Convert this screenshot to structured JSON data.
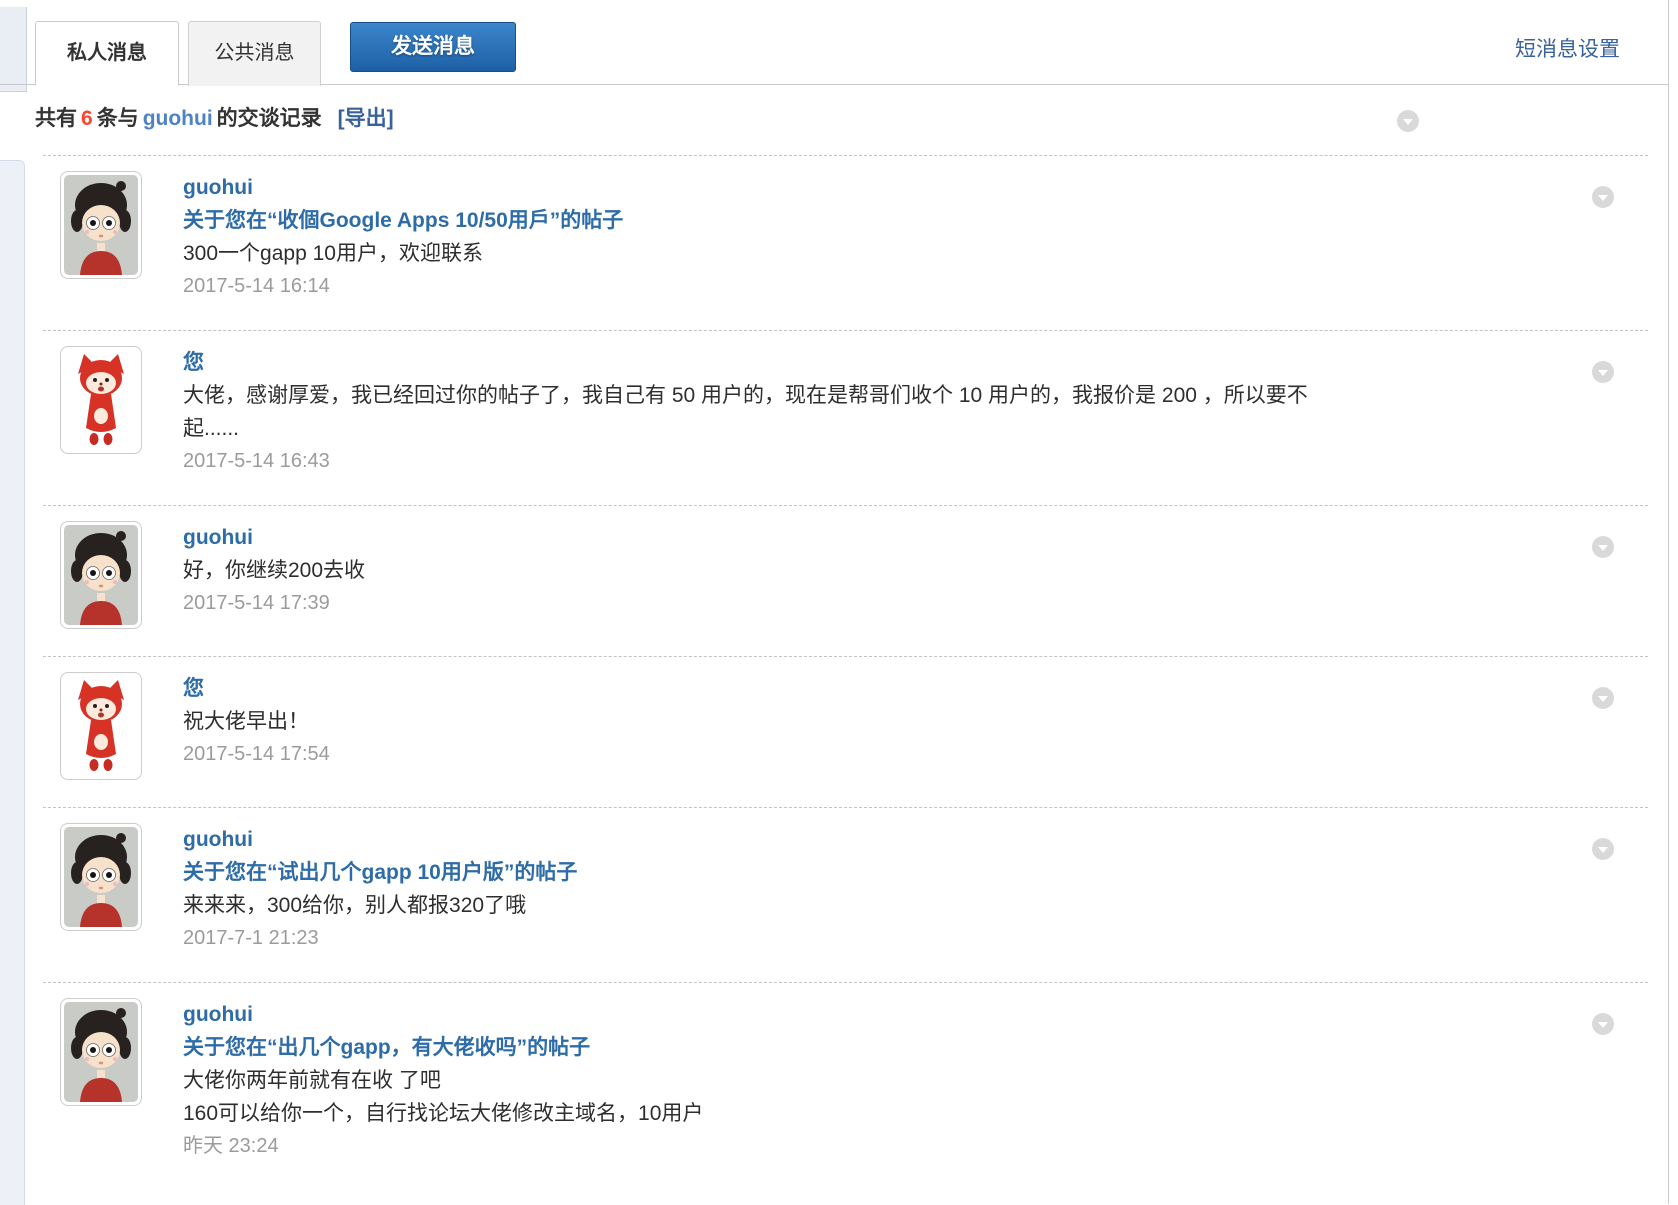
{
  "tabs": {
    "private": "私人消息",
    "public": "公共消息",
    "send": "发送消息"
  },
  "settings_link": "短消息设置",
  "header": {
    "prefix": "共有",
    "count": "6",
    "middle": "条与",
    "user": "guohui",
    "suffix": "的交谈记录",
    "export": "[导出]"
  },
  "messages": [
    {
      "avatar": "boy",
      "name": "guohui",
      "subject": "关于您在“收個Google Apps 10/50用戶”的帖子",
      "lines": [
        "300一个gapp 10用户，欢迎联系"
      ],
      "time": "2017-5-14 16:14"
    },
    {
      "avatar": "fox",
      "name": "您",
      "lines": [
        "大佬，感谢厚爱，我已经回过你的帖子了，我自己有 50 用户的，现在是帮哥们收个 10 用户的，我报价是 200 ，所以要不起......"
      ],
      "time": "2017-5-14 16:43"
    },
    {
      "avatar": "boy",
      "name": "guohui",
      "lines": [
        "好，你继续200去收"
      ],
      "time": "2017-5-14 17:39"
    },
    {
      "avatar": "fox",
      "name": "您",
      "lines": [
        "祝大佬早出！"
      ],
      "time": "2017-5-14 17:54"
    },
    {
      "avatar": "boy",
      "name": "guohui",
      "subject": "关于您在“试出几个gapp 10用户版”的帖子",
      "lines": [
        "来来来，300给你，别人都报320了哦"
      ],
      "time": "2017-7-1 21:23"
    },
    {
      "avatar": "boy",
      "name": "guohui",
      "subject": "关于您在“出几个gapp，有大佬收吗”的帖子",
      "lines": [
        "大佬你两年前就有在收 了吧",
        "160可以给你一个，自行找论坛大佬修改主域名，10用户"
      ],
      "time": "昨天 23:24"
    }
  ],
  "icons": {
    "header_arrow": "chevron-down",
    "row_arrow": "chevron-down",
    "avatar_boy": "boy-avatar",
    "avatar_fox": "fox-avatar"
  },
  "colors": {
    "accent_blue": "#2e6ca8",
    "link_blue": "#38629b",
    "count_red": "#ff4433",
    "button_blue": "#1d5fa5",
    "tab_border": "#c9c9c9",
    "time_gray": "#9b9b9b"
  }
}
